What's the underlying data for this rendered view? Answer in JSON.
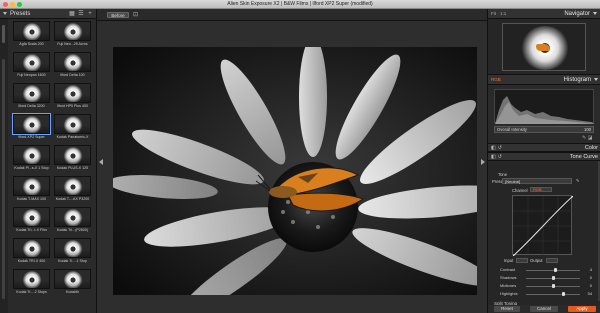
{
  "window": {
    "title": "Alien Skin Exposure X2 | B&W Films | Ilford XP2 Super (modified)"
  },
  "presets": {
    "title": "Presets",
    "items": [
      {
        "label": "Agfa Scala 200"
      },
      {
        "label": "Fuji Neo...29 Acros"
      },
      {
        "label": "Fuji Neopan 1600"
      },
      {
        "label": "Ilford Delta 100"
      },
      {
        "label": "Ilford Delta 3200"
      },
      {
        "label": "Ilford HP5 Plus 400"
      },
      {
        "label": "Ilford XP2 Super"
      },
      {
        "label": "Kodak Panatomic-X"
      },
      {
        "label": "Kodak Pl...s-X 1 Stop"
      },
      {
        "label": "Kodak PLUS-X 125"
      },
      {
        "label": "Kodak T-MAX 100"
      },
      {
        "label": "Kodak T-...AX P3200"
      },
      {
        "label": "Kodak Tri...t-X Film"
      },
      {
        "label": "Kodak Tri...(P2600)"
      },
      {
        "label": "Kodak TRI-X 400"
      },
      {
        "label": "Kodak Tr...-1 Stop"
      },
      {
        "label": "Kodak Tr...-2 Stops"
      },
      {
        "label": "Kodalith"
      }
    ]
  },
  "toolbar": {
    "before_label": "Before"
  },
  "right": {
    "fit_label": "Fit",
    "zoom_label": "1:1",
    "navigator_title": "Navigator",
    "histogram_channel": "RGB",
    "histogram_title": "Histogram",
    "overall_label": "Overall Intensity",
    "overall_value": "100",
    "color_title": "Color",
    "tone_curve_title": "Tone Curve",
    "tone_label": "Tone",
    "preset_label": "Preset",
    "preset_value": "[Neutral]",
    "channel_label": "Channel",
    "channel_value": "RGB",
    "input_label": "Input",
    "output_label": "Output",
    "sliders": [
      {
        "label": "Contrast",
        "value": "4"
      },
      {
        "label": "Shadows",
        "value": "0"
      },
      {
        "label": "Midtones",
        "value": "0"
      },
      {
        "label": "Highlights",
        "value": "34"
      }
    ],
    "split_toning_label": "Split Toning",
    "reset_label": "Reset",
    "cancel_label": "Cancel",
    "apply_label": "Apply"
  },
  "colors": {
    "accent": "#e15a1e",
    "butterfly": "#d97f1e",
    "background": "#1e1e1e"
  }
}
